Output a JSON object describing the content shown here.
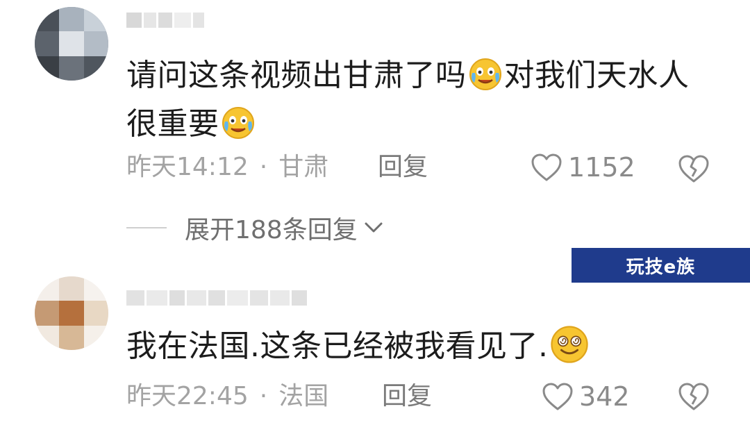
{
  "comments": [
    {
      "text_line1_part1": "请问这条视频出甘肃了吗",
      "text_line1_part2": "对我们天水人",
      "text_line2": "很重要",
      "emoji": "crying-laughing-emoji",
      "time": "昨天14:12",
      "separator": "·",
      "location": "甘肃",
      "reply_label": "回复",
      "like_count": "1152",
      "expand_label": "展开188条回复"
    },
    {
      "text": "我在法国.这条已经被我看见了.",
      "emoji": "dizzy-smile-emoji",
      "time": "昨天22:45",
      "separator": "·",
      "location": "法国",
      "reply_label": "回复",
      "like_count": "342"
    }
  ],
  "watermark": {
    "text": "玩技e族"
  },
  "colors": {
    "text_primary": "#1c1c1c",
    "text_meta": "#a3a3a3",
    "icon": "#8a8a8a",
    "watermark_bg": "#1f3b8c"
  }
}
